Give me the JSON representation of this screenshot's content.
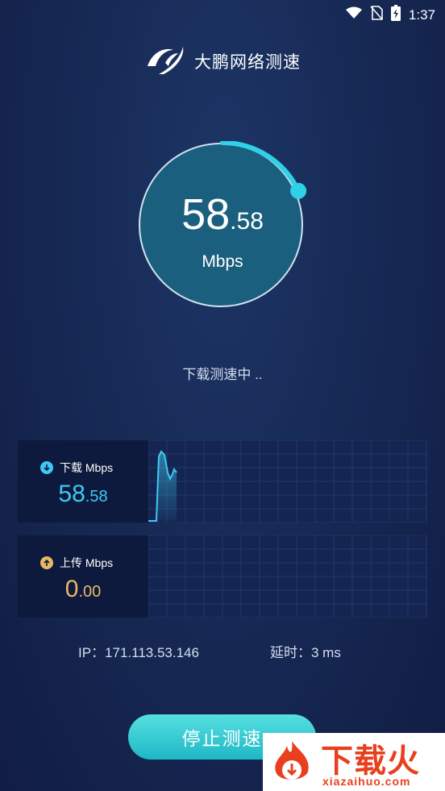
{
  "status_bar": {
    "time": "1:37"
  },
  "app": {
    "name": "大鹏网络测速"
  },
  "gauge": {
    "speed_int": "58",
    "speed_dec": ".58",
    "unit": "Mbps",
    "progress": 0.18
  },
  "test_status": "下载测速中 ..",
  "download": {
    "label": "下载 Mbps",
    "value_int": "58",
    "value_dec": ".58"
  },
  "upload": {
    "label": "上传 Mbps",
    "value_int": "0",
    "value_dec": ".00"
  },
  "info": {
    "ip": "IP：171.113.53.146",
    "latency": "延时：3 ms"
  },
  "stop_button": {
    "label": "停止测速"
  },
  "watermark": {
    "title": "下载火",
    "url": "xiazaihuo.com"
  },
  "colors": {
    "accent": "#2fd1e8",
    "download": "#3ec9f0",
    "upload": "#e8b865",
    "button": "#2cc5d0"
  }
}
